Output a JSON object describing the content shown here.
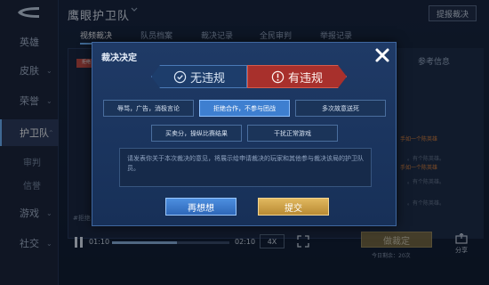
{
  "sidebar": {
    "items": [
      {
        "label": "英雄",
        "chev": ""
      },
      {
        "label": "皮肤",
        "chev": "⌄"
      },
      {
        "label": "荣誉",
        "chev": "⌄"
      },
      {
        "label": "护卫队",
        "chev": "⌃"
      }
    ],
    "subitems": [
      "审判",
      "信誉"
    ],
    "more": [
      {
        "label": "游戏",
        "chev": "⌄"
      },
      {
        "label": "社交",
        "chev": "⌄"
      }
    ]
  },
  "header": {
    "title": "鹰眼护卫队",
    "report_button": "提报裁决"
  },
  "tabs": [
    {
      "label": "视频裁决",
      "active": true
    },
    {
      "label": "队员档案",
      "active": false
    },
    {
      "label": "裁决记录",
      "active": false
    },
    {
      "label": "全民审判",
      "active": false
    },
    {
      "label": "举报记录",
      "active": false
    }
  ],
  "background": {
    "right_header": "参考信息",
    "notes": [
      "手如一个陈英雄",
      "。有个陈英雄。",
      "手如一个陈英雄",
      "。有个陈英雄。",
      "。有个陈英雄。"
    ],
    "hash_text": "#拒绝",
    "reason_tag": "拒绝"
  },
  "player": {
    "current_time": "01:10",
    "end_time": "02:10",
    "speed": "4X",
    "progress": 0.55
  },
  "judge_button": "做裁定",
  "count_text": "今日剩余：20次",
  "share_label": "分享",
  "modal": {
    "title": "裁决决定",
    "verdict_no": "无违规",
    "verdict_yes": "有违规",
    "options": [
      {
        "label": "辱骂，广告，消极言论",
        "selected": false
      },
      {
        "label": "拒绝合作，不参与团战",
        "selected": true
      },
      {
        "label": "多次故意送死",
        "selected": false
      },
      {
        "label": "买卖分，操纵比赛结果",
        "selected": false
      },
      {
        "label": "干扰正常游戏",
        "selected": false
      }
    ],
    "reason_placeholder": "请发表你关于本次裁决的意见，将展示给申请裁决的玩家和其他参与裁决该局的护卫队员。",
    "rethink_button": "再想想",
    "submit_button": "提交"
  },
  "colors": {
    "accent_blue": "#3e7fd0",
    "violation_red": "#a8302c",
    "submit_gold": "#c99a40"
  }
}
